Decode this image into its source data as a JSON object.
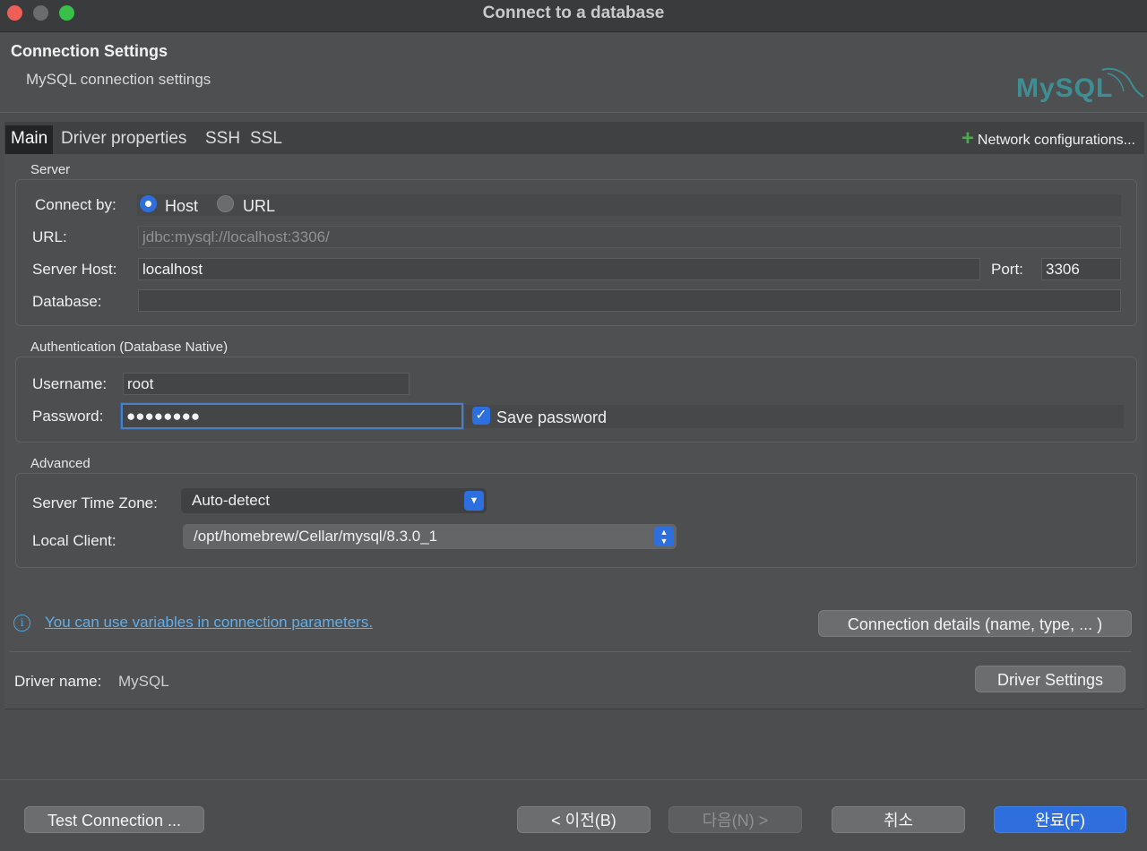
{
  "window": {
    "title": "Connect to a database"
  },
  "header": {
    "title": "Connection Settings",
    "subtitle": "MySQL connection settings",
    "logo_text": "MySQL"
  },
  "tabs": [
    {
      "label": "Main"
    },
    {
      "label": "Driver properties"
    },
    {
      "label": "SSH"
    },
    {
      "label": "SSL"
    }
  ],
  "network_config": {
    "label": "Network configurations..."
  },
  "server": {
    "section": "Server",
    "connect_by_label": "Connect by:",
    "option_host": "Host",
    "option_url": "URL",
    "url_label": "URL:",
    "url_value": "jdbc:mysql://localhost:3306/",
    "host_label": "Server Host:",
    "host_value": "localhost",
    "port_label": "Port:",
    "port_value": "3306",
    "database_label": "Database:",
    "database_value": ""
  },
  "auth": {
    "section": "Authentication (Database Native)",
    "username_label": "Username:",
    "username_value": "root",
    "password_label": "Password:",
    "password_value": "●●●●●●●●",
    "save_password_label": "Save password"
  },
  "advanced": {
    "section": "Advanced",
    "timezone_label": "Server Time Zone:",
    "timezone_value": "Auto-detect",
    "local_client_label": "Local Client:",
    "local_client_value": "/opt/homebrew/Cellar/mysql/8.3.0_1"
  },
  "info": {
    "link_text": "You can use variables in connection parameters.",
    "details_button": "Connection details (name, type, ... )"
  },
  "driver": {
    "label": "Driver name:",
    "value": "MySQL",
    "settings_button": "Driver Settings"
  },
  "footer": {
    "test_button": "Test Connection ...",
    "back_button": "< 이전(B)",
    "next_button": "다음(N) >",
    "cancel_button": "취소",
    "finish_button": "완료(F)"
  },
  "colors": {
    "accent": "#2e6fe0",
    "link": "#5eaef0",
    "plus": "#4ea84e",
    "logo": "#3e8e93"
  }
}
